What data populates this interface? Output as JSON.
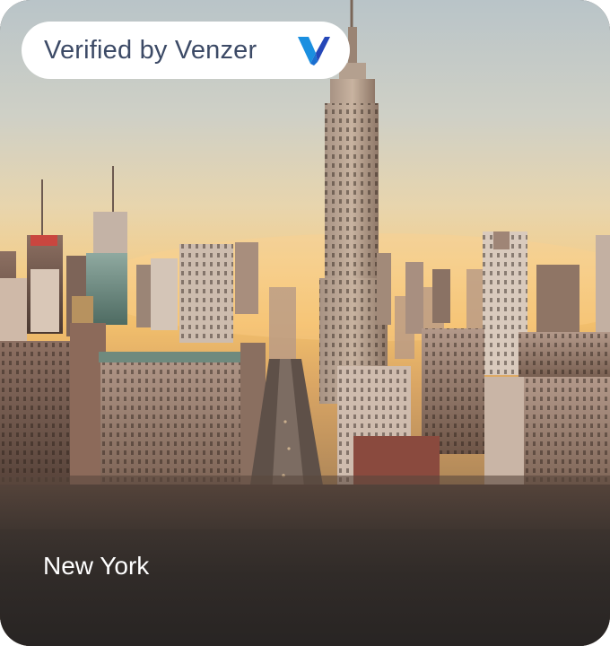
{
  "badge": {
    "label": "Verified by Venzer",
    "logo_icon": "venzer-v-logo-icon",
    "logo_colors": [
      "#1a8fe0",
      "#2547b8"
    ]
  },
  "card": {
    "city_name": "New York",
    "image_description_icon": "city-skyline-photo"
  }
}
